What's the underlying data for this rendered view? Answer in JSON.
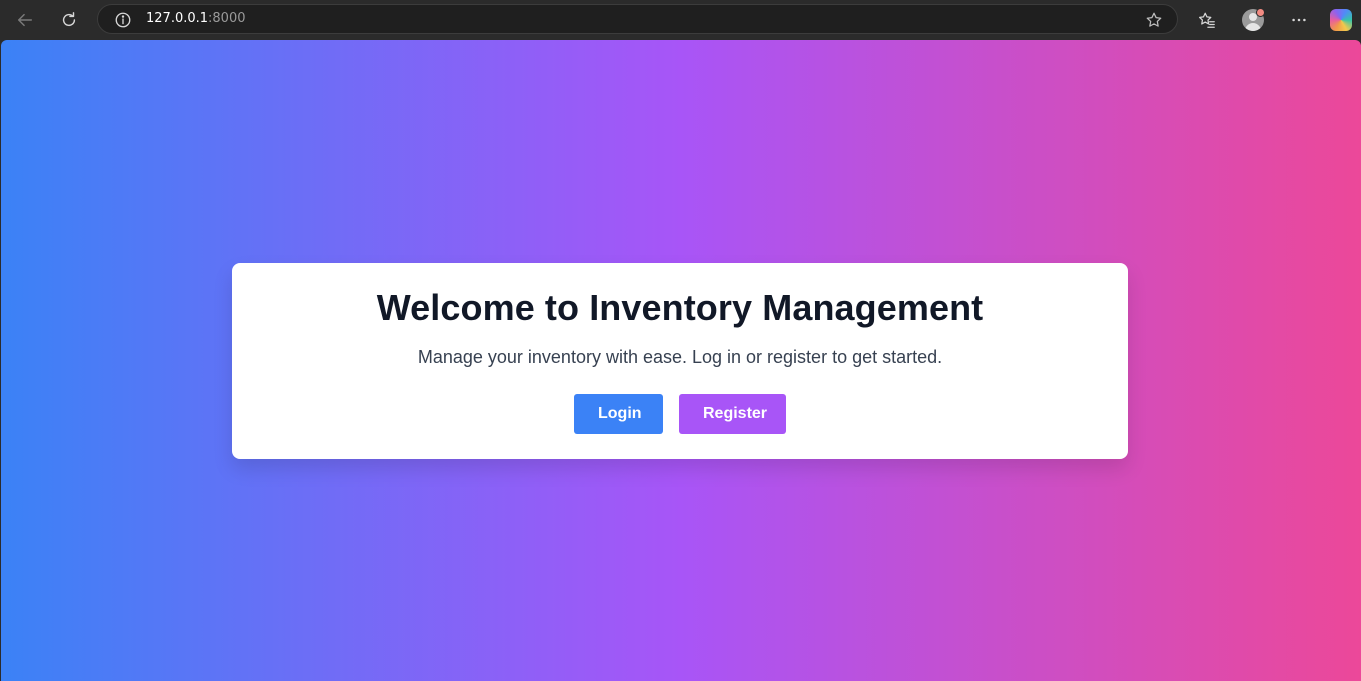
{
  "browser": {
    "address": {
      "host": "127.0.0.1",
      "port": ":8000"
    },
    "icons": {
      "back": "back-arrow-icon",
      "reload": "reload-icon",
      "site_info": "info-icon",
      "favorite": "star-icon",
      "favorites": "favorites-icon",
      "profile": "profile-icon",
      "menu": "more-icon",
      "copilot": "copilot-icon"
    }
  },
  "colors": {
    "gradient_start": "#3b82f6",
    "gradient_mid": "#a855f7",
    "gradient_end": "#ec4899",
    "login_button": "#3b82f6",
    "register_button": "#a855f7",
    "title_text": "#111827"
  },
  "page": {
    "title": "Welcome to Inventory Management",
    "subtitle": "Manage your inventory with ease. Log in or register to get started.",
    "login_label": "Login",
    "register_label": "Register"
  }
}
